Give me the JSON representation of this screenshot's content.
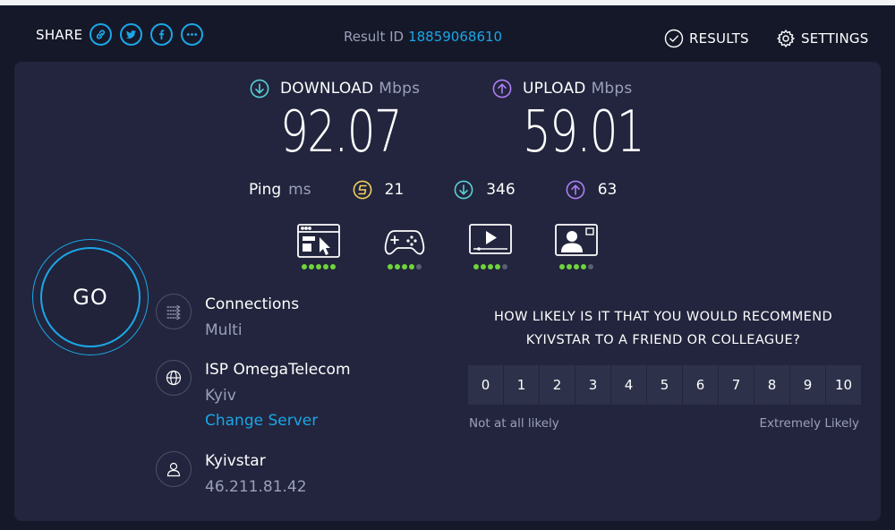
{
  "header": {
    "share_label": "SHARE",
    "share_icons": [
      "link-icon",
      "twitter-icon",
      "facebook-icon",
      "more-icon"
    ],
    "result_label": "Result ID",
    "result_id": "18859068610",
    "results_label": "RESULTS",
    "settings_label": "SETTINGS"
  },
  "download": {
    "label": "DOWNLOAD",
    "unit": "Mbps",
    "value": "92.07"
  },
  "upload": {
    "label": "UPLOAD",
    "unit": "Mbps",
    "value": "59.01"
  },
  "ping": {
    "label": "Ping",
    "unit": "ms",
    "idle": "21",
    "download": "346",
    "upload": "63"
  },
  "apps": [
    {
      "icon": "web-browsing-icon",
      "rating": 5
    },
    {
      "icon": "gaming-icon",
      "rating": 4
    },
    {
      "icon": "video-streaming-icon",
      "rating": 4
    },
    {
      "icon": "video-call-icon",
      "rating": 4
    }
  ],
  "go_label": "GO",
  "connections": {
    "title": "Connections",
    "value": "Multi"
  },
  "server": {
    "title": "ISP OmegaTelecom",
    "location": "Kyiv",
    "change_label": "Change Server"
  },
  "provider": {
    "title": "Kyivstar",
    "ip": "46.211.81.42"
  },
  "survey": {
    "question_line1": "HOW LIKELY IS IT THAT YOU WOULD RECOMMEND",
    "question_line2": "KYIVSTAR TO A FRIEND OR COLLEAGUE?",
    "scale": [
      "0",
      "1",
      "2",
      "3",
      "4",
      "5",
      "6",
      "7",
      "8",
      "9",
      "10"
    ],
    "low_label": "Not at all likely",
    "high_label": "Extremely Likely"
  },
  "colors": {
    "accent": "#1ba6e6",
    "download": "#5ad1d6",
    "upload": "#b07ef5",
    "ping": "#f3d05c",
    "rating_on": "#6fd43b"
  }
}
